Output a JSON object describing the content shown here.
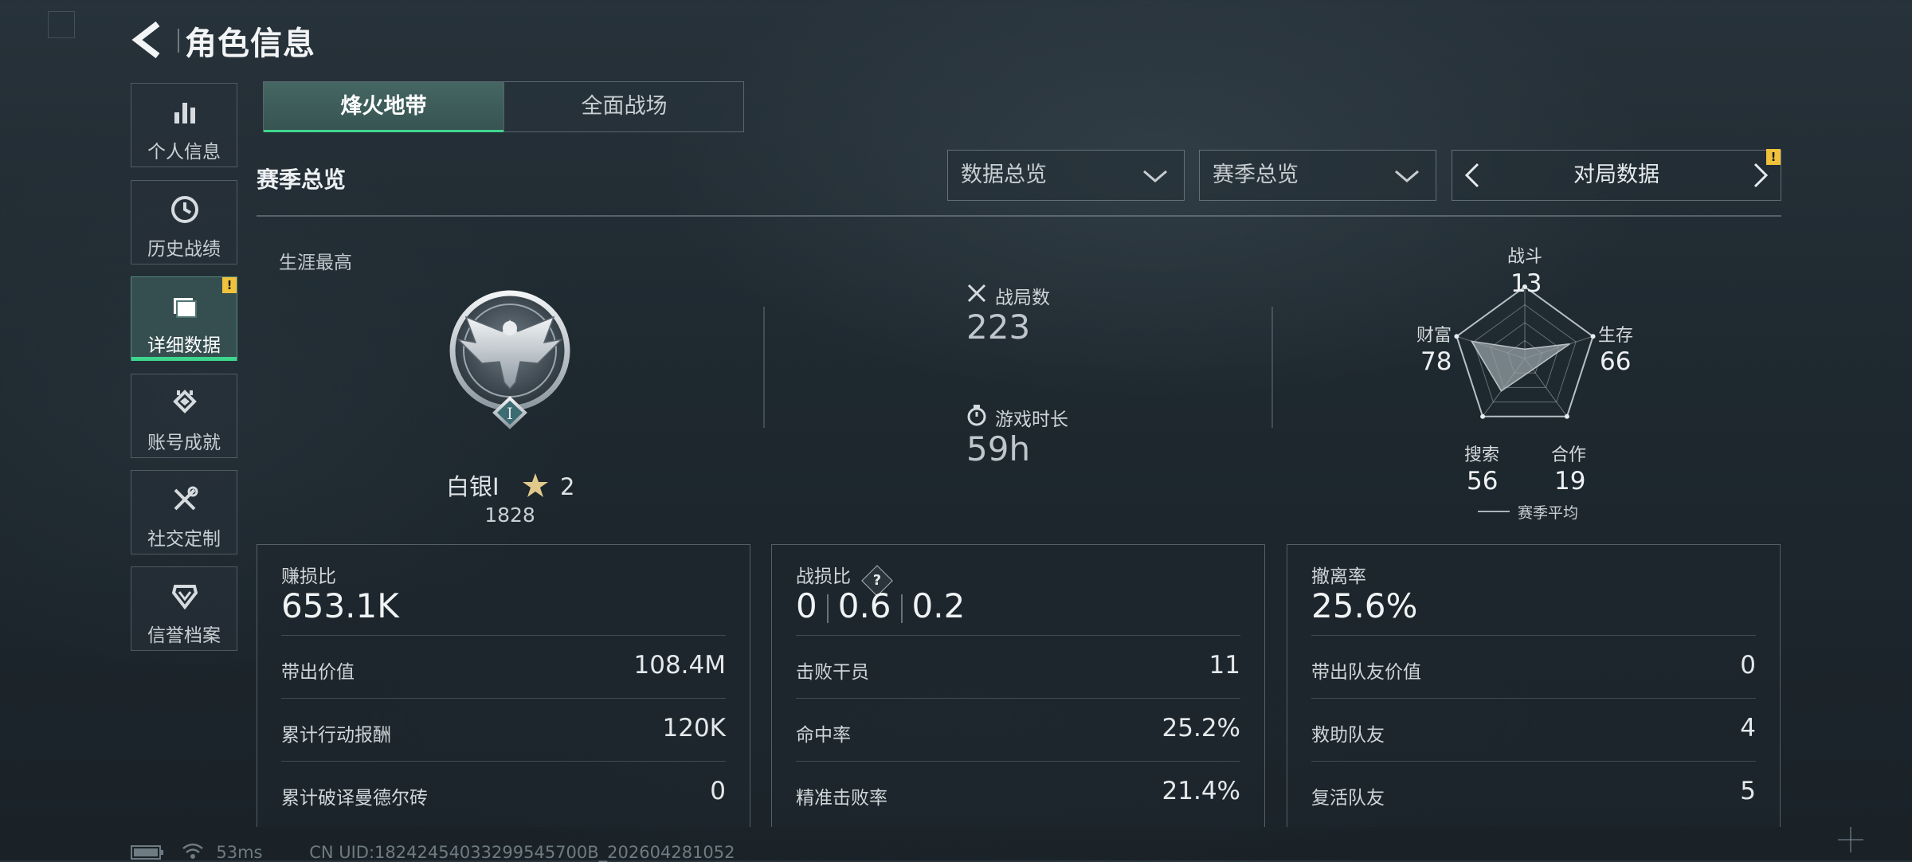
{
  "header": {
    "title": "角色信息"
  },
  "sidebar": {
    "items": [
      {
        "label": "个人信息",
        "icon": "bar-chart-icon"
      },
      {
        "label": "历史战绩",
        "icon": "clock-icon"
      },
      {
        "label": "详细数据",
        "icon": "folder-icon",
        "active": true,
        "badge": "!"
      },
      {
        "label": "账号成就",
        "icon": "achievement-icon"
      },
      {
        "label": "社交定制",
        "icon": "tools-icon"
      },
      {
        "label": "信誉档案",
        "icon": "shield-icon"
      }
    ]
  },
  "tabs": [
    {
      "label": "烽火地带",
      "active": true
    },
    {
      "label": "全面战场",
      "active": false
    }
  ],
  "section_title": "赛季总览",
  "filters": {
    "data_select": "数据总览",
    "season_select": "赛季总览",
    "pager_label": "对局数据",
    "pager_badge": "!"
  },
  "career": {
    "label": "生涯最高",
    "rank_name": "白银I",
    "stars": "2",
    "score": "1828"
  },
  "stats": {
    "matches_label": "战局数",
    "matches_value": "223",
    "playtime_label": "游戏时长",
    "playtime_value": "59h"
  },
  "radar": {
    "axes": [
      {
        "label": "战斗",
        "value": "13"
      },
      {
        "label": "生存",
        "value": "66"
      },
      {
        "label": "合作",
        "value": "19"
      },
      {
        "label": "搜索",
        "value": "56"
      },
      {
        "label": "财富",
        "value": "78"
      }
    ],
    "legend": "赛季平均"
  },
  "cards": [
    {
      "label": "赚损比",
      "big": "653.1K",
      "rows": [
        {
          "label": "带出价值",
          "value": "108.4M"
        },
        {
          "label": "累计行动报酬",
          "value": "120K"
        },
        {
          "label": "累计破译曼德尔砖",
          "value": "0"
        }
      ]
    },
    {
      "label": "战损比",
      "help": "?",
      "big_parts": [
        "0",
        "0.6",
        "0.2"
      ],
      "rows": [
        {
          "label": "击败干员",
          "value": "11"
        },
        {
          "label": "命中率",
          "value": "25.2%"
        },
        {
          "label": "精准击败率",
          "value": "21.4%"
        }
      ]
    },
    {
      "label": "撤离率",
      "big": "25.6%",
      "rows": [
        {
          "label": "带出队友价值",
          "value": "0"
        },
        {
          "label": "救助队友",
          "value": "4"
        },
        {
          "label": "复活队友",
          "value": "5"
        }
      ]
    }
  ],
  "footer": {
    "ping": "53ms",
    "uid": "CN UID:18242454033299545700B_202604281052"
  },
  "colors": {
    "accent": "#3dd68c",
    "badge": "#f0c23c"
  }
}
